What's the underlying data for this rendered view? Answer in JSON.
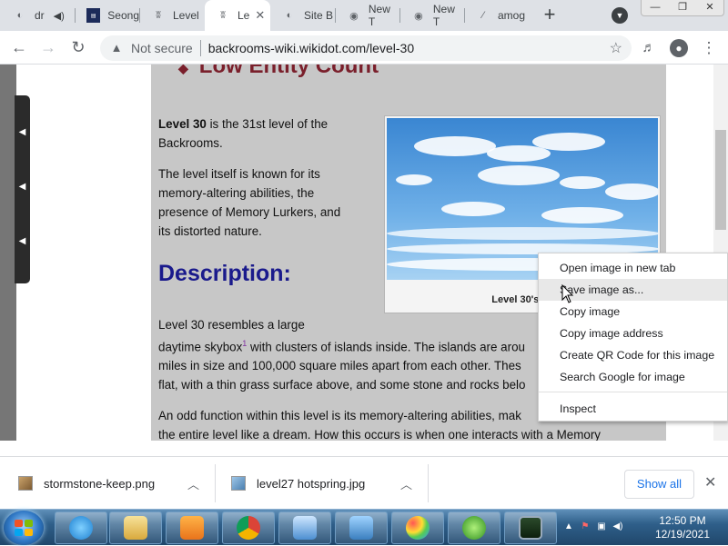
{
  "browser": {
    "tabs": [
      {
        "label": "dr",
        "icon": "globe-icon",
        "audio": true
      },
      {
        "label": "Seong",
        "icon": "site-favicon-icon"
      },
      {
        "label": "Level",
        "icon": "wikidot-icon"
      },
      {
        "label": "Le",
        "icon": "wikidot-icon",
        "active": true
      },
      {
        "label": "Site B",
        "icon": "globe-icon"
      },
      {
        "label": "New T",
        "icon": "chrome-icon"
      },
      {
        "label": "New T",
        "icon": "chrome-icon"
      },
      {
        "label": "amog",
        "icon": "tool-icon"
      }
    ],
    "new_tab_label": "+",
    "not_secure_label": "Not secure",
    "url": "backrooms-wiki.wikidot.com/level-30"
  },
  "page": {
    "top_heading": "Low Entity Count",
    "intro_bold": "Level 30",
    "intro_rest": " is the 31st level of the",
    "intro_line2": "Backrooms.",
    "p2_lines": [
      "The level itself is known for its",
      "memory-altering abilities, the",
      "presence of Memory Lurkers, and",
      "its distorted nature."
    ],
    "description_heading": "Description:",
    "p3_line1": "Level 30 resembles a large",
    "p3_line2a": "daytime skybox",
    "p3_sup": "1",
    "p3_line2b": " with clusters of islands inside. The islands are arou",
    "p3_line3": "miles in size and 100,000 square miles apart from each other. Thes",
    "p3_line4": "flat, with a thin grass surface above, and some stone and rocks belo",
    "p4_line1": "An odd function within this level is its memory-altering abilities, mak",
    "p4_line2": "the entire level like a dream. How this occurs is when one interacts with a Memory",
    "image_caption": "Level 30's sk"
  },
  "context_menu": {
    "items": [
      "Open image in new tab",
      "Save image as...",
      "Copy image",
      "Copy image address",
      "Create QR Code for this image",
      "Search Google for image",
      "Inspect"
    ]
  },
  "downloads": {
    "items": [
      "stormstone-keep.png",
      "level27 hotspring.jpg"
    ],
    "show_all_label": "Show all"
  },
  "taskbar": {
    "time": "12:50 PM",
    "date": "12/19/2021"
  }
}
